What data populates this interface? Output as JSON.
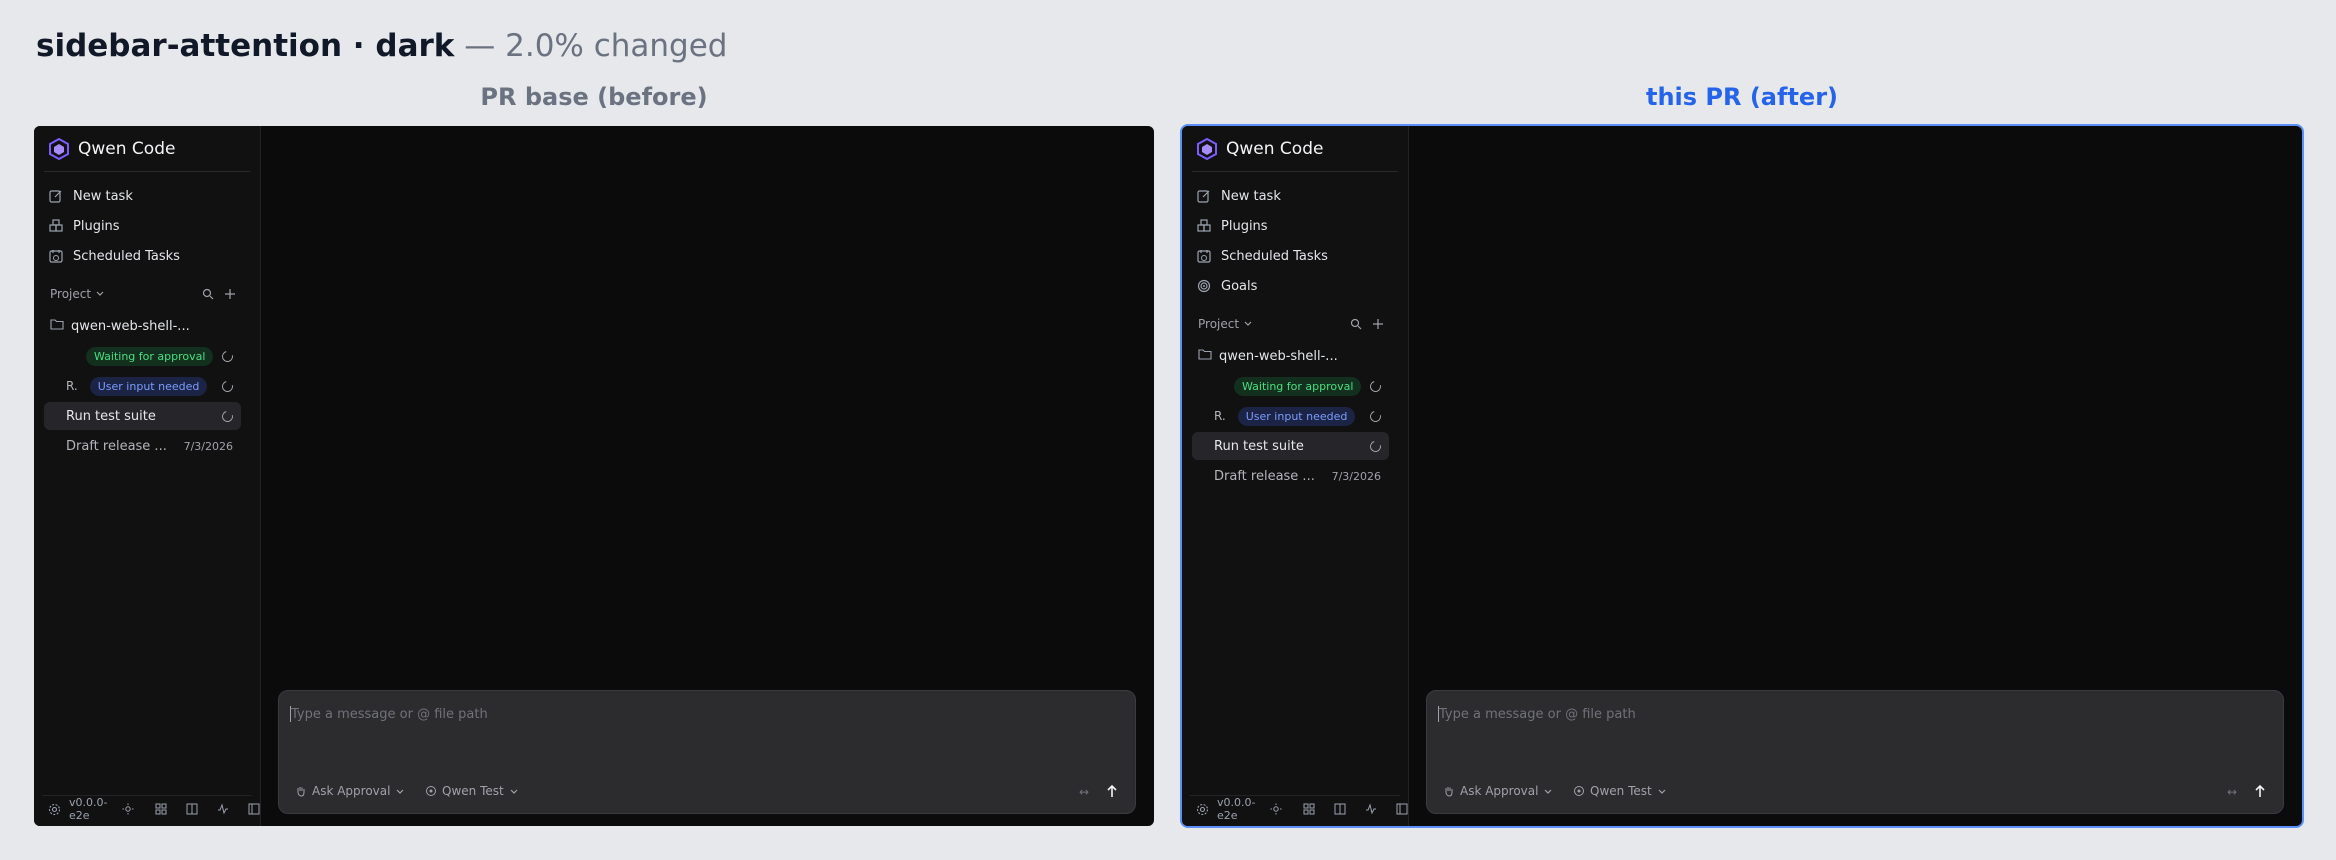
{
  "header": {
    "title": "sidebar-attention · dark",
    "subtitle": " — 2.0% changed"
  },
  "panels": {
    "before": {
      "title": "PR base (before)",
      "app_name": "Qwen Code",
      "nav": [
        {
          "label": "New task",
          "icon": "edit-icon"
        },
        {
          "label": "Plugins",
          "icon": "plugin-icon"
        },
        {
          "label": "Scheduled Tasks",
          "icon": "calendar-clock-icon"
        }
      ],
      "project_label": "Project",
      "folder": "qwen-web-shell-...",
      "tasks": [
        {
          "prefix": "",
          "badge": "Waiting for approval",
          "badge_color": "#4ade80"
        },
        {
          "prefix": "R.",
          "badge": "User input needed",
          "badge_color": "#7c9cff"
        },
        {
          "label": "Run test suite"
        },
        {
          "label": "Draft release ...",
          "date": "7/3/2026"
        }
      ],
      "version": "v0.0.0-e2e",
      "composer": {
        "placeholder": "Type a message or @ file path",
        "approval": "Ask Approval",
        "model": "Qwen Test",
        "expand": "↔",
        "send": "↑"
      }
    },
    "after": {
      "title": "this PR (after)",
      "app_name": "Qwen Code",
      "nav": [
        {
          "label": "New task",
          "icon": "edit-icon"
        },
        {
          "label": "Plugins",
          "icon": "plugin-icon"
        },
        {
          "label": "Scheduled Tasks",
          "icon": "calendar-clock-icon"
        },
        {
          "label": "Goals",
          "icon": "target-icon"
        }
      ],
      "project_label": "Project",
      "folder": "qwen-web-shell-...",
      "tasks": [
        {
          "prefix": "",
          "badge": "Waiting for approval",
          "badge_color": "#4ade80"
        },
        {
          "prefix": "R.",
          "badge": "User input needed",
          "badge_color": "#7c9cff"
        },
        {
          "label": "Run test suite"
        },
        {
          "label": "Draft release ...",
          "date": "7/3/2026"
        }
      ],
      "version": "v0.0.0-e2e",
      "composer": {
        "placeholder": "Type a message or @ file path",
        "approval": "Ask Approval",
        "model": "Qwen Test",
        "expand": "↔",
        "send": "↑"
      }
    }
  },
  "colors": {
    "page_bg": "#e6e8ec",
    "app_bg": "#0b0b0c",
    "sidebar_bg": "#111112",
    "accent_after": "#2563eb",
    "badge_green": "#4ade80",
    "badge_blue": "#7c9cff"
  }
}
